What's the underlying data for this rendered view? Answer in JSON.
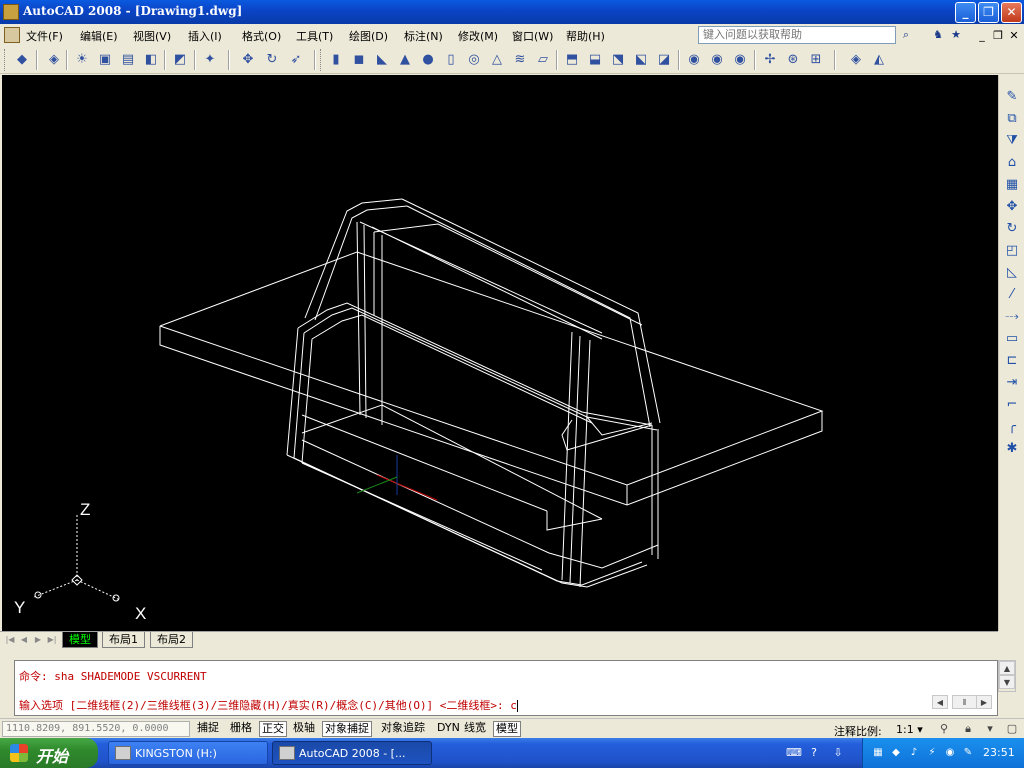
{
  "window": {
    "title": "AutoCAD 2008 - [Drawing1.dwg]",
    "minimize": "_",
    "restore": "❐",
    "close": "✕"
  },
  "menu": {
    "items": [
      "文件(F)",
      "编辑(E)",
      "视图(V)",
      "插入(I)",
      "格式(O)",
      "工具(T)",
      "绘图(D)",
      "标注(N)",
      "修改(M)",
      "窗口(W)",
      "帮助(H)"
    ],
    "help_placeholder": "键入问题以获取帮助",
    "mdi_min": "_",
    "mdi_restore": "❐",
    "mdi_close": "✕"
  },
  "tabs": {
    "model": "模型",
    "layout1": "布局1",
    "layout2": "布局2"
  },
  "command": {
    "line1": "命令: sha SHADEMODE VSCURRENT",
    "line2": "输入选项 [二维线框(2)/三维线框(3)/三维隐藏(H)/真实(R)/概念(C)/其他(O)] <二维线框>: c"
  },
  "statusbar": {
    "coords": "1110.8209, 891.5520, 0.0000",
    "toggles": [
      {
        "label": "捕捉",
        "on": false
      },
      {
        "label": "栅格",
        "on": false
      },
      {
        "label": "正交",
        "on": true
      },
      {
        "label": "极轴",
        "on": false
      },
      {
        "label": "对象捕捉",
        "on": true
      },
      {
        "label": "对象追踪",
        "on": false
      },
      {
        "label": "DYN",
        "on": false
      },
      {
        "label": "线宽",
        "on": false
      },
      {
        "label": "模型",
        "on": true
      }
    ],
    "anno_scale_label": "注释比例:",
    "anno_scale_value": "1:1 ▾"
  },
  "ucs": {
    "x": "X",
    "y": "Y",
    "z": "Z"
  },
  "taskbar": {
    "start": "开始",
    "tasks": [
      {
        "label": "KINGSTON (H:)",
        "active": false
      },
      {
        "label": "AutoCAD 2008 - [...",
        "active": true
      }
    ],
    "clock": "23:51"
  },
  "colors": {
    "titlebar": "#0b46c8",
    "viewport_bg": "#000000",
    "wireframe": "#ffffff",
    "command_text": "#c00000",
    "model_tab_text": "#00ff00"
  }
}
